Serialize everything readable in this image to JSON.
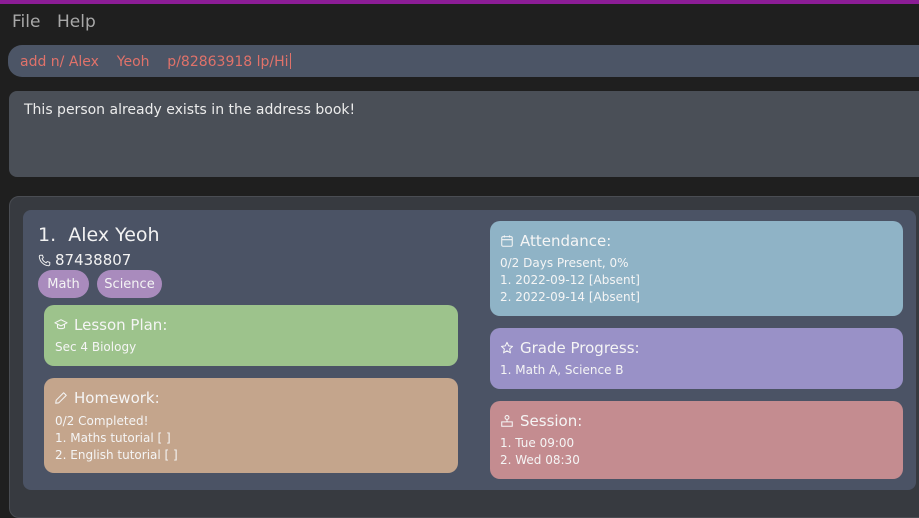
{
  "menu": {
    "file": "File",
    "help": "Help"
  },
  "command": {
    "value": "add n/ Alex    Yeoh    p/82863918 lp/Hi"
  },
  "result": {
    "message": "This person already exists in the address book!"
  },
  "person": {
    "index_name": "1.  Alex Yeoh",
    "phone": "87438807",
    "tags": [
      "Math",
      "Science"
    ],
    "lesson_plan": {
      "title": "Lesson Plan:",
      "content": "Sec 4 Biology"
    },
    "homework": {
      "title": "Homework:",
      "summary": "0/2 Completed!",
      "items": [
        "1. Maths tutorial [ ]",
        "2. English tutorial [ ]"
      ]
    },
    "attendance": {
      "title": "Attendance:",
      "summary": "0/2 Days Present, 0%",
      "items": [
        "1. 2022-09-12 [Absent]",
        "2. 2022-09-14 [Absent]"
      ]
    },
    "grade_progress": {
      "title": "Grade Progress:",
      "items": [
        "1. Math A, Science B"
      ]
    },
    "session": {
      "title": "Session:",
      "items": [
        "1. Tue 09:00",
        "2. Wed 08:30"
      ]
    }
  },
  "colors": {
    "accent_bar": "#8c1d96",
    "command_text": "#e0726a",
    "lesson_plan": "#9dc38c",
    "homework": "#c4a58c",
    "attendance": "#8fb3c6",
    "grade_progress": "#9991c7",
    "session": "#c48c90",
    "tag": "#a98bbd"
  }
}
